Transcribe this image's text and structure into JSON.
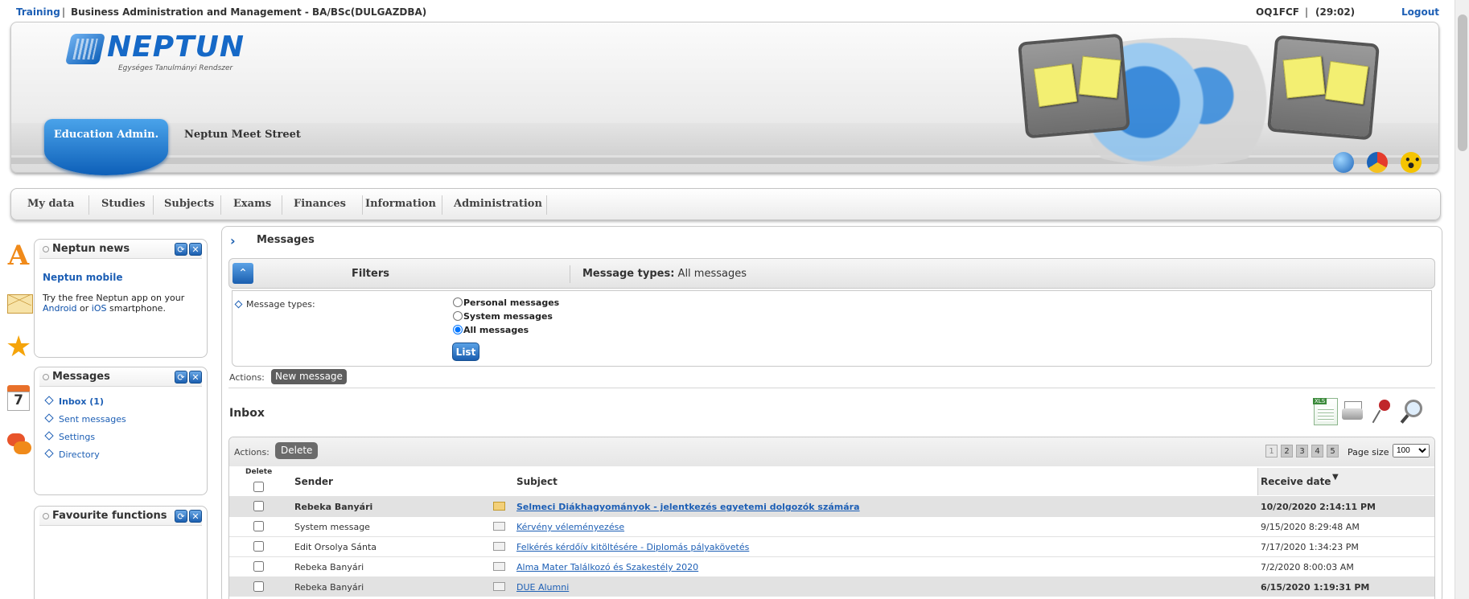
{
  "topbar": {
    "training": "Training",
    "separator": "|",
    "program": "Business Administration and Management - BA/BSc(DULGAZDBA)",
    "user_code": "OQ1FCF",
    "separator2": "|",
    "session_timer": "(29:02)",
    "logout": "Logout"
  },
  "header": {
    "logo_name": "NEPTUN",
    "logo_subtitle": "Egységes Tanulmányi Rendszer",
    "tab_active": "Education Admin.",
    "tab_other": "Neptun Meet Street",
    "icons": [
      "globe-icon",
      "color-theme-icon",
      "accessibility-icon"
    ]
  },
  "mainmenu": [
    "My data",
    "Studies",
    "Subjects",
    "Exams",
    "Finances",
    "Information",
    "Administration"
  ],
  "rail_icons": [
    "a-icon",
    "mail-icon",
    "star-icon",
    "calendar-icon",
    "chat-icon"
  ],
  "rail_calendar_number": "7",
  "sidebar": {
    "news": {
      "title": "Neptun news",
      "item_title": "Neptun mobile",
      "text_before": "Try the free Neptun app on your",
      "link_android": "Android",
      "text_or": "or",
      "link_ios": "iOS",
      "text_after": "smartphone."
    },
    "messages": {
      "title": "Messages",
      "links": [
        "Inbox (1)",
        "Sent messages",
        "Settings",
        "Directory"
      ]
    },
    "favourites": {
      "title": "Favourite functions"
    }
  },
  "content": {
    "breadcrumb": "Messages",
    "filters_label": "Filters",
    "summary_label": "Message types:",
    "summary_value": "All messages",
    "message_types_label": "Message types:",
    "radio_options": [
      "Personal messages",
      "System messages",
      "All messages"
    ],
    "radio_selected": 2,
    "list_button": "List",
    "actions_label": "Actions:",
    "new_message_button": "New message",
    "inbox_title": "Inbox",
    "tools": [
      "xls-export-icon",
      "print-icon",
      "pin-icon",
      "search-icon"
    ],
    "grid": {
      "actions_label": "Actions:",
      "delete_button": "Delete",
      "pages": [
        "1",
        "2",
        "3",
        "4",
        "5"
      ],
      "current_page": 1,
      "page_size_label": "Page size",
      "page_size": "100",
      "headers": {
        "delete": "Delete",
        "sender": "Sender",
        "subject": "Subject",
        "receive_date": "Receive date"
      },
      "rows": [
        {
          "sender": "Rebeka Banyári",
          "subject": "Selmeci Diákhagyományok - jelentkezés egyetemi dolgozók számára",
          "date": "10/20/2020 2:14:11 PM",
          "unread": true
        },
        {
          "sender": "System message",
          "subject": "Kérvény véleményezése",
          "date": "9/15/2020 8:29:48 AM",
          "unread": false
        },
        {
          "sender": "Edit Orsolya Sánta",
          "subject": "Felkérés kérdőív kitöltésére - Diplomás pályakövetés",
          "date": "7/17/2020 1:34:23 PM",
          "unread": false
        },
        {
          "sender": "Rebeka Banyári",
          "subject": "Alma Mater Találkozó és Szakestély 2020",
          "date": "7/2/2020 8:00:03 AM",
          "unread": false
        },
        {
          "sender": "Rebeka Banyári",
          "subject": "DUE Alumni",
          "date": "6/15/2020 1:19:31 PM",
          "unread": false
        }
      ]
    }
  },
  "colors": {
    "accent_blue": "#1b5fb0",
    "link_blue": "#1d5fb5",
    "unread_envelope": "#f3d079"
  }
}
